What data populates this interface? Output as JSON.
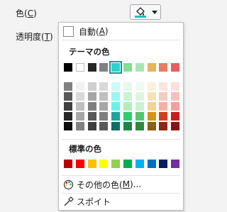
{
  "labels": {
    "color": "色(C)",
    "color_base": "色(",
    "color_key": "C",
    "color_tail": ")",
    "transparency_base": "透明度(",
    "transparency_key": "T",
    "transparency_tail": ")"
  },
  "button": {
    "fill_color": "#22c0c0",
    "icon": "paint-bucket-icon"
  },
  "popup": {
    "auto_base": "自動(",
    "auto_key": "A",
    "auto_tail": ")",
    "theme_title": "テーマの色",
    "standard_title": "標準の色",
    "more_base": "その他の色(",
    "more_key": "M",
    "more_tail": ")...",
    "eyedropper": "スポイト",
    "theme_top": [
      "#000000",
      "#ffffff",
      "#262626",
      "#808080",
      "#2ed3c9",
      "#7fe08f",
      "#a9e6b3",
      "#e8b459",
      "#e87c65",
      "#e85e5e"
    ],
    "theme_shades": [
      [
        "#808080",
        "#595959",
        "#404040",
        "#262626",
        "#0d0d0d"
      ],
      [
        "#f2f2f2",
        "#d9d9d9",
        "#bfbfbf",
        "#a6a6a6",
        "#808080"
      ],
      [
        "#d0d0d0",
        "#a6a6a6",
        "#7f7f7f",
        "#595959",
        "#3f3f3f"
      ],
      [
        "#d9d9d9",
        "#bfbfbf",
        "#a6a6a6",
        "#7f7f7f",
        "#595959"
      ],
      [
        "#ccfbf9",
        "#99f7f3",
        "#66f3ed",
        "#1fa39b",
        "#146c67"
      ],
      [
        "#e5f9e8",
        "#cbf3d2",
        "#b2edbb",
        "#2ecc71",
        "#1e8449"
      ],
      [
        "#eefaf0",
        "#ddf5e1",
        "#cbf0d2",
        "#58c46e",
        "#2b8a3e"
      ],
      [
        "#fbf0dc",
        "#f7e1b9",
        "#f3d296",
        "#d89218",
        "#8d5f10"
      ],
      [
        "#fbe5e0",
        "#f7cbc1",
        "#f3b1a2",
        "#d1411f",
        "#8b2b14"
      ],
      [
        "#fbdfdf",
        "#f7bfbf",
        "#f39f9f",
        "#c81e1e",
        "#851414"
      ]
    ],
    "standard": [
      "#c00000",
      "#ff0000",
      "#ffc000",
      "#ffff00",
      "#92d050",
      "#00b050",
      "#00b0f0",
      "#0070c0",
      "#002060",
      "#7030a0"
    ]
  }
}
